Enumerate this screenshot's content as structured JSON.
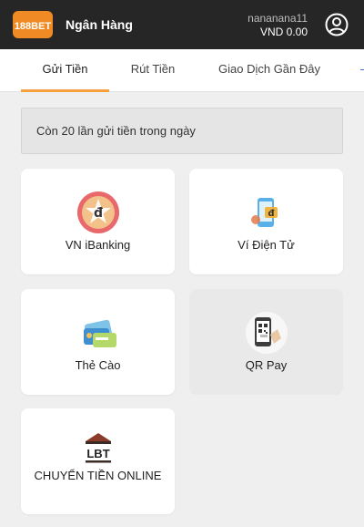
{
  "header": {
    "logo_text": "188BET",
    "title": "Ngân Hàng",
    "username": "nananana11",
    "balance": "VND 0.00",
    "account_icon": "account-circle-icon"
  },
  "tabs": [
    {
      "label": "Gửi Tiền",
      "active": true
    },
    {
      "label": "Rút Tiền",
      "active": false
    },
    {
      "label": "Giao Dịch Gần Đây",
      "active": false
    }
  ],
  "notice": "Còn 20 lần gửi tiền trong ngày",
  "methods": [
    {
      "label": "VN iBanking",
      "icon": "ibanking-dong-badge-icon"
    },
    {
      "label": "Ví Điện Tử",
      "icon": "e-wallet-phone-icon"
    },
    {
      "label": "Thẻ Cào",
      "icon": "scratch-cards-icon"
    },
    {
      "label": "QR Pay",
      "icon": "qr-pay-phone-icon",
      "selected": true
    },
    {
      "label": "CHUYỂN TIỀN ONLINE",
      "icon": "lbt-bank-icon"
    }
  ],
  "colors": {
    "header_bg": "#262626",
    "accent": "#f7a23e",
    "page_bg": "#efefef",
    "brand_orange": "#f08a24"
  }
}
